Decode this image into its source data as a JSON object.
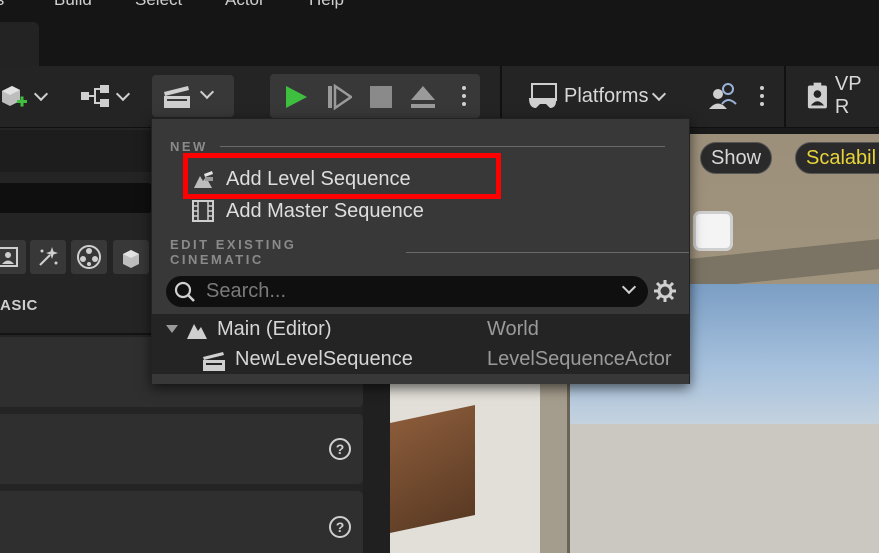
{
  "menubar": {
    "items": [
      "ls",
      "Build",
      "Select",
      "Actor",
      "Help"
    ]
  },
  "toolbar": {
    "platforms_label": "Platforms",
    "vp_label": "VP R"
  },
  "left_panel": {
    "section_label": "ASIC"
  },
  "viewport": {
    "show_label": "Show",
    "scalability_label": "Scalabil",
    "scalability_color": "#e8d43a"
  },
  "dropdown": {
    "new_section": "NEW",
    "new_items": [
      {
        "label": "Add Level Sequence",
        "icon": "level-sequence-icon"
      },
      {
        "label": "Add Master Sequence",
        "icon": "film-strip-icon"
      }
    ],
    "edit_section": "EDIT EXISTING CINEMATIC",
    "search_placeholder": "Search...",
    "tree": [
      {
        "name": "Main (Editor)",
        "type": "World",
        "icon": "world-icon",
        "expanded": true
      },
      {
        "name": "NewLevelSequence",
        "type": "LevelSequenceActor",
        "icon": "clapperboard-icon"
      }
    ],
    "highlight_color": "#ff0000"
  }
}
